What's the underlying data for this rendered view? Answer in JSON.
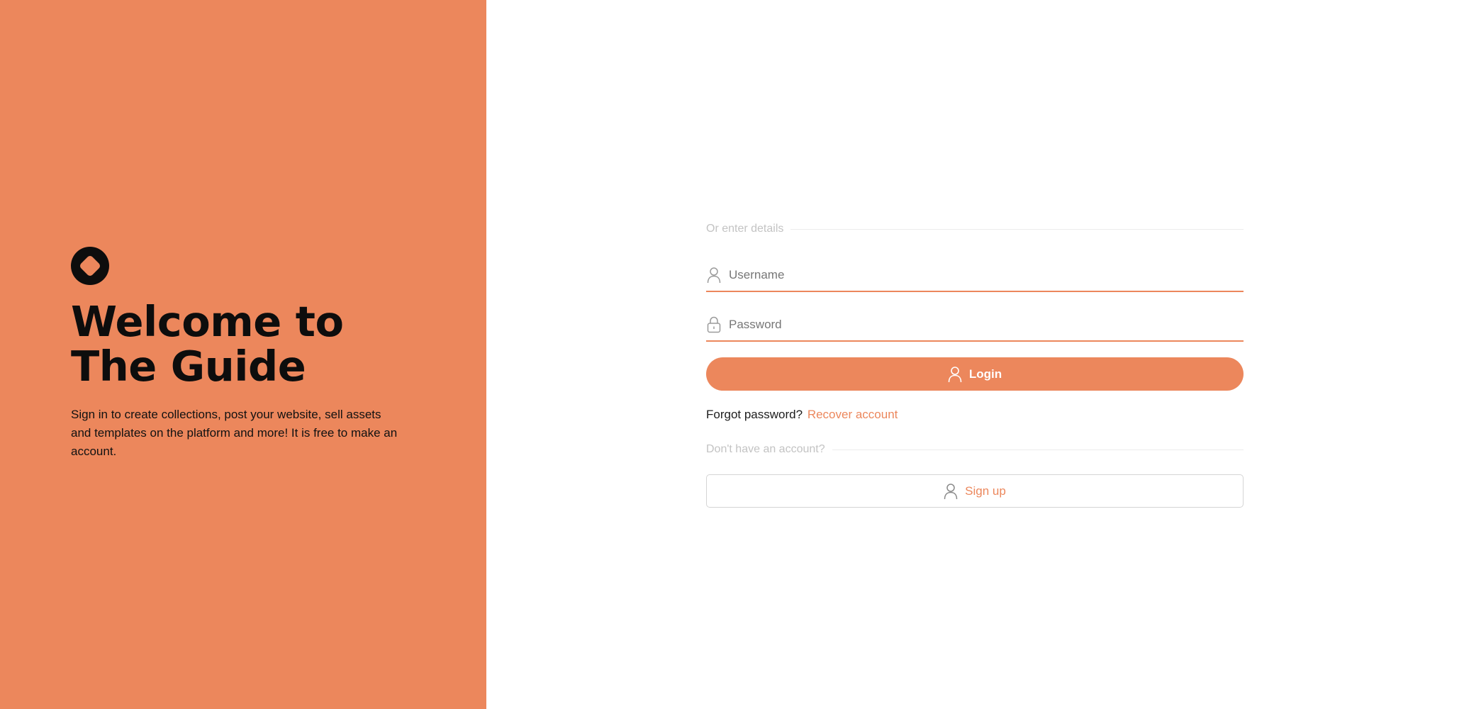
{
  "colors": {
    "accent": "#ec875c",
    "left_panel_bg": "#ec875c",
    "title_text": "#0d0d0d",
    "muted_text": "#c3c3c3",
    "border": "#d4d4d4"
  },
  "left_panel": {
    "logo_icon": "rounded-diamond-ring-logo",
    "title_line1": "Welcome to",
    "title_line2": "The Guide",
    "description": "Sign in to create collections, post your website, sell assets and templates on the platform and more! It is free to make an account."
  },
  "form": {
    "details_divider": "Or enter details",
    "username": {
      "icon": "user-icon",
      "placeholder": "Username",
      "value": ""
    },
    "password": {
      "icon": "lock-icon",
      "placeholder": "Password",
      "value": ""
    },
    "login_button": {
      "icon": "user-icon",
      "label": "Login"
    },
    "forgot_password": {
      "text": "Forgot password?",
      "link_label": "Recover account"
    },
    "signup_divider": "Don't have an account?",
    "signup_button": {
      "icon": "user-icon",
      "label": "Sign up"
    }
  }
}
